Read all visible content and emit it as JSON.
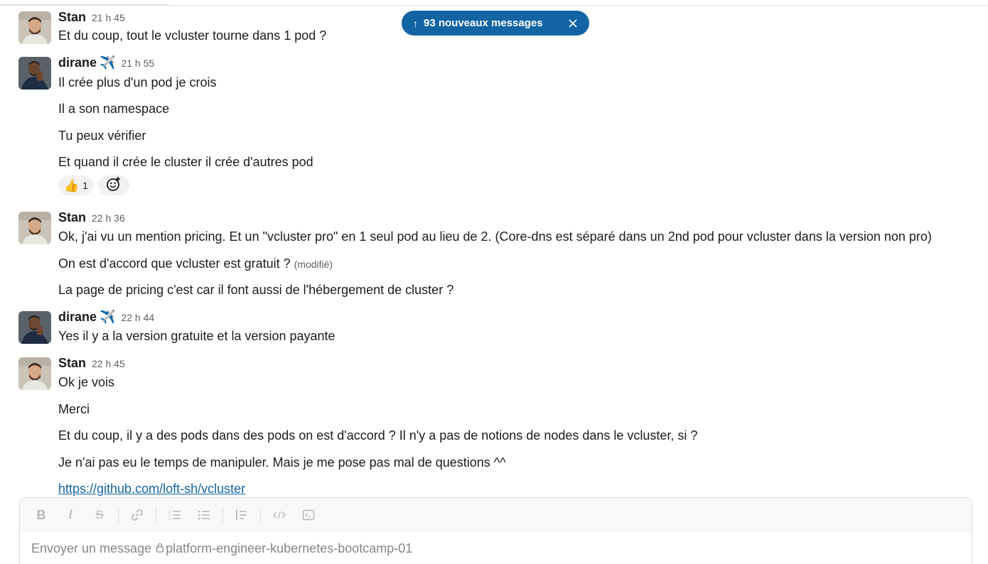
{
  "banner": {
    "label": "93 nouveaux messages",
    "arrow_icon": "arrow-up-icon",
    "close_icon": "close-icon"
  },
  "groups": [
    {
      "author": "Stan",
      "status_emoji": "",
      "time": "21 h 45",
      "avatar": "stan",
      "lines": [
        "Et du coup, tout le vcluster tourne dans 1 pod ?"
      ]
    },
    {
      "author": "dirane",
      "status_emoji": "✈️",
      "time": "21 h 55",
      "avatar": "dirane",
      "lines": [
        "Il crée plus d'un pod je crois",
        "Il a son namespace",
        "Tu peux vérifier",
        "Et quand il crée le cluster il crée d'autres pod"
      ],
      "reactions": [
        {
          "emoji": "👍",
          "count": "1"
        }
      ]
    },
    {
      "author": "Stan",
      "status_emoji": "",
      "time": "22 h 36",
      "avatar": "stan",
      "lines": [
        "Ok, j'ai vu un mention pricing. Et un \"vcluster pro\"  en 1 seul pod au lieu de 2. (Core-dns est séparé dans un 2nd pod pour vcluster dans la version non pro)",
        "On est d'accord que vcluster est gratuit ?",
        "La page de pricing c'est car il font aussi de l'hébergement de cluster ?"
      ],
      "edited_label": "(modifié)"
    },
    {
      "author": "dirane",
      "status_emoji": "✈️",
      "time": "22 h 44",
      "avatar": "dirane",
      "lines": [
        "Yes il y a la version gratuite et la version payante"
      ]
    },
    {
      "author": "Stan",
      "status_emoji": "",
      "time": "22 h 45",
      "avatar": "stan",
      "lines": [
        "Ok je vois",
        "Merci",
        "Et du coup, il y a des pods dans des pods on est d'accord ? Il n'y a pas de notions de nodes dans le vcluster, si ?",
        "Je n'ai pas eu le temps de manipuler. Mais je me pose pas mal de questions ^^",
        "https://github.com/loft-sh/vcluster"
      ]
    }
  ],
  "composer": {
    "placeholder_prefix": "Envoyer un message",
    "channel": "platform-engineer-kubernetes-bootcamp-01",
    "tools": [
      "bold-icon",
      "italic-icon",
      "strikethrough-icon",
      "link-icon",
      "ordered-list-icon",
      "bullet-list-icon",
      "blockquote-icon",
      "code-icon",
      "code-block-icon"
    ]
  },
  "colors": {
    "accent": "#1264a3",
    "text": "#1d1c1d",
    "muted": "#616061"
  }
}
